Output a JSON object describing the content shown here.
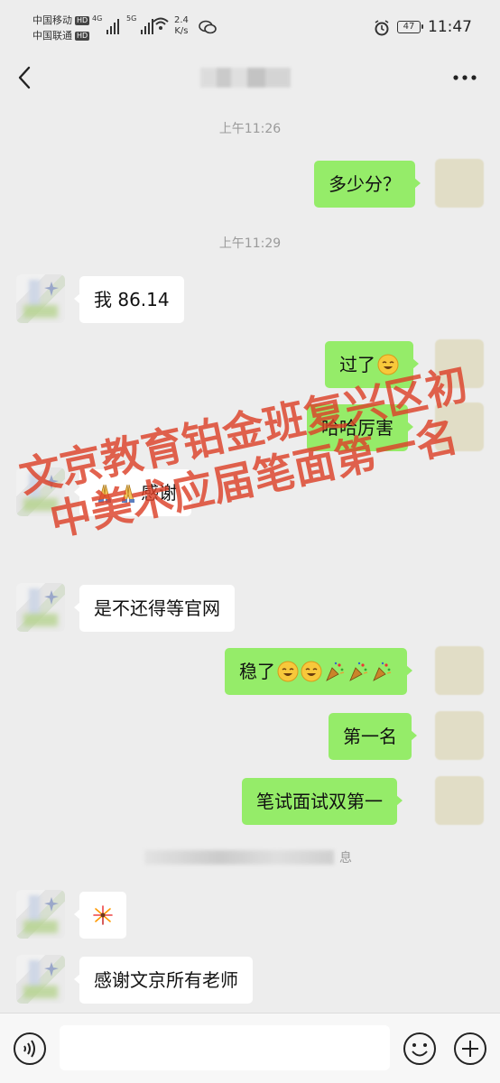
{
  "status_bar": {
    "carrier1": "中国移动",
    "carrier2": "中国联通",
    "hd": "HD",
    "net_gen1": "4G",
    "net_gen2": "5G",
    "speed_value": "2.4",
    "speed_unit": "K/s",
    "battery": "47",
    "time": "11:47"
  },
  "nav": {
    "back_icon": "chevron-left-icon",
    "more_icon": "more-dots-icon"
  },
  "messages": {
    "time1": "上午11:26",
    "m1": "多少分？",
    "time2": "上午11:29",
    "m2": "我 86.14",
    "m3": "过了",
    "m4": "哈哈厉害",
    "m5": "感谢",
    "m6": "是不还得等官网",
    "m7": "稳了",
    "m8": "第一名",
    "m9": "笔试面试双第一",
    "sys_tail": "息",
    "m11": "感谢文京所有老师"
  },
  "watermark": {
    "line1": "文京教育铂金班复兴区初",
    "line2": "中美术应届笔面第一名"
  },
  "input_bar": {
    "voice_icon": "voice-icon",
    "emoji_icon": "smile-icon",
    "plus_icon": "plus-circle-icon",
    "input_value": ""
  },
  "colors": {
    "background": "#ededed",
    "outgoing_bubble": "#95ec69",
    "incoming_bubble": "#ffffff",
    "watermark": "#dc4128"
  }
}
